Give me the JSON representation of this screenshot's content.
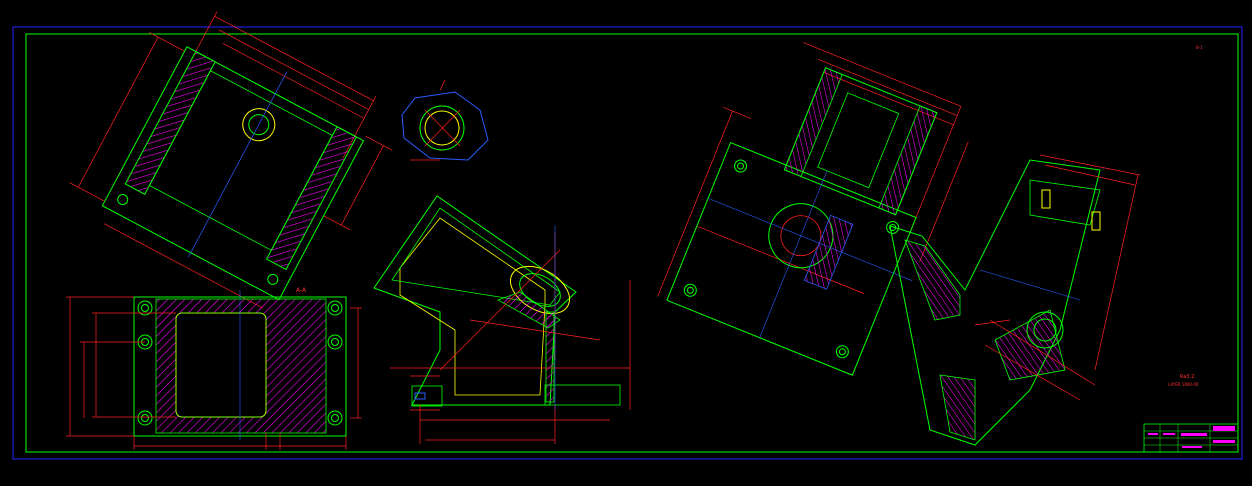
{
  "drawing": {
    "colors": {
      "background": "#000000",
      "outer_frame": "#2323ff",
      "inner_frame": "#00ff00",
      "outline": "#00ff00",
      "dimension": "#ff2020",
      "hatch": "#ff00ff",
      "highlight": "#ffff00",
      "centerline": "#2a5cff",
      "text": "#ff3030"
    },
    "labels": {
      "section_a": "A-A",
      "note_main": "Ra3.2",
      "note_line": "LAYER 1000-00",
      "view_corner": "B-1"
    },
    "title_block": {
      "rows": [
        "",
        "",
        "",
        ""
      ],
      "title": "",
      "number": ""
    }
  }
}
